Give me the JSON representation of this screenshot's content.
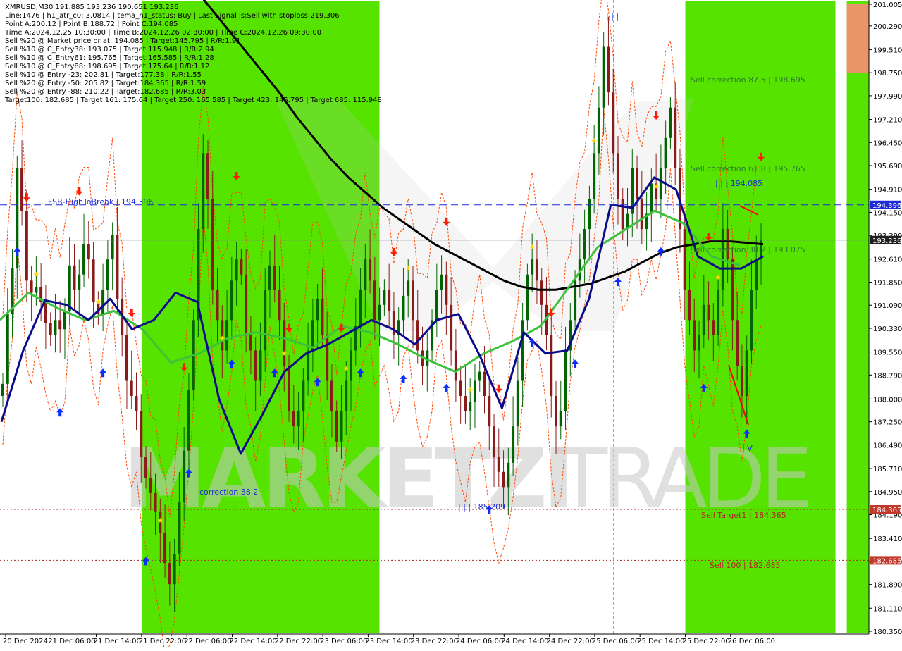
{
  "colors": {
    "background": "#ffffff",
    "bull_candle": "#006400",
    "bear_candle": "#8b1a1a",
    "zone_green": "#56e300",
    "zone_orange": "#e8956a",
    "ma_long": "#000000",
    "ma_mid": "#3cc23c",
    "ma_fast": "#0a0a8a",
    "level_line": "#1f2bd8",
    "target_line": "#b22222",
    "envelope": "#ff4500",
    "arrow_up": "#0a2cff",
    "arrow_down": "#ff1a00",
    "star": "#ffd400",
    "current_price_label_bg": "#202020",
    "level_label_bg": "#1f2bd8",
    "target_label_bg": "#c0392b",
    "watermark": "#c8c8c8",
    "watermark_green": "#1a8a5a"
  },
  "info_lines": [
    "XMRUSD,M30  191.885 193.236 190.651 193.236",
    "Line:1476  |  h1_atr_c0: 3.0814  |  tema_h1_status: Buy  |  Last Signal is:Sell with stoploss:219.306",
    "Point A:200.12  |  Point B:188.72  |  Point C:194.085",
    "Time A:2024.12.25 10:30:00  |  Time B:2024.12.26 02:30:00  |  Time C:2024.12.26 09:30:00",
    "Sell %20 @ Market price or at: 194.085  |  Target:145.795  |  R/R:1.91",
    "Sell %10 @ C_Entry38: 193.075  |  Target:115.948  |  R/R:2.94",
    "Sell %10 @ C_Entry61: 195.765  |  Target:165.585  |  R/R:1.28",
    "Sell %10 @ C_Entry88: 198.695  |  Target:175.64  |  R/R:1.12",
    "Sell %10 @ Entry -23: 202.81  |  Target:177.38  |  R/R:1.55",
    "Sell %20 @ Entry -50: 205.82  |  Target:184.365  |  R/R:1.59",
    "Sell %20 @ Entry -88: 210.22  |  Target:182.685  |  R/R:3.03",
    "Target100: 182.685  |  Target 161: 175.64  |  Target 250: 165.585  |  Target 423: 145.795  |  Target 685: 115.948"
  ],
  "annotations": {
    "fsb_label": "FSB-HighToBreak | 194.396",
    "sell_corr_875": "Sell correction 87.5 | 198.695",
    "sell_corr_618": "Sell correction 61.8 | 195.765",
    "sell_corr_382": "Sell correction 38.2 | 193.075",
    "point_c": "| | | 194.085",
    "point_b": "| | | 185.209",
    "point_a": "| | |",
    "point_v": "| V",
    "sell_target1": "Sell Target1 | 184.365",
    "sell_100": "Sell 100 | 182.685",
    "correction_382": "correction 38.2"
  },
  "watermark": {
    "left": "MARKETZI",
    "right": "TRADE"
  },
  "chart_data": {
    "type": "candlestick",
    "symbol": "XMRUSD",
    "timeframe": "M30",
    "ylim": [
      180.35,
      201.005
    ],
    "price_ticks": [
      "201.005",
      "200.290",
      "199.510",
      "198.750",
      "197.990",
      "197.210",
      "196.450",
      "195.690",
      "194.910",
      "194.150",
      "193.390",
      "192.610",
      "191.850",
      "191.090",
      "190.330",
      "189.550",
      "188.790",
      "188.000",
      "187.250",
      "186.490",
      "185.710",
      "184.950",
      "184.190",
      "183.410",
      "182.650",
      "181.890",
      "181.110",
      "180.350"
    ],
    "time_ticks": [
      "20 Dec 2024",
      "21 Dec 06:00",
      "21 Dec 14:00",
      "21 Dec 22:00",
      "22 Dec 06:00",
      "22 Dec 14:00",
      "22 Dec 22:00",
      "23 Dec 06:00",
      "23 Dec 14:00",
      "23 Dec 22:00",
      "24 Dec 06:00",
      "24 Dec 14:00",
      "24 Dec 22:00",
      "25 Dec 06:00",
      "25 Dec 14:00",
      "25 Dec 22:00",
      "26 Dec 06:00"
    ],
    "current_price": "193.236",
    "levels": [
      {
        "name": "FSB-HighToBreak",
        "price": 194.396,
        "label": "194.396",
        "style": "dashed"
      },
      {
        "name": "Sell Target1",
        "price": 184.365,
        "label": "184.365",
        "style": "dotted"
      },
      {
        "name": "Sell 100",
        "price": 182.685,
        "label": "182.685",
        "style": "dotted"
      }
    ],
    "green_zones": [
      {
        "from": "21 Dec 22:00",
        "to": "22 Dec 04:00"
      },
      {
        "from": "22 Dec 08:00",
        "to": "22 Dec 12:00"
      },
      {
        "from": "22 Dec 14:00",
        "to": "22 Dec 18:00"
      },
      {
        "from": "25 Dec 22:00",
        "to": "26 Dec 02:30"
      },
      {
        "from": "26 Dec 04:30",
        "to": "26 Dec 09:00"
      },
      {
        "from": "26 Dec 10:30",
        "to": "26 Dec 14:30"
      }
    ],
    "orange_zone": {
      "from": "26 Dec 04:30",
      "to": "26 Dec 09:00",
      "price_from": 198.75,
      "price_to": 201.005
    },
    "close_series": [
      188.5,
      190.8,
      192.3,
      195.6,
      194.2,
      191.9,
      191.5,
      191.7,
      191.2,
      190.5,
      190.1,
      190.6,
      190.3,
      190.9,
      192.4,
      191.6,
      192.1,
      193.1,
      192.6,
      191.2,
      190.8,
      191.6,
      192.6,
      193.4,
      191.3,
      190.1,
      188.6,
      188.1,
      187.6,
      186.1,
      185.4,
      184.9,
      184.3,
      183.6,
      182.6,
      181.9,
      182.9,
      184.6,
      186.3,
      188.3,
      190.6,
      193.6,
      196.1,
      194.6,
      191.6,
      190.6,
      189.6,
      190.6,
      191.9,
      192.6,
      192.1,
      190.1,
      189.6,
      188.6,
      189.6,
      191.6,
      192.4,
      191.6,
      190.6,
      189.1,
      187.6,
      187.1,
      187.6,
      188.6,
      189.6,
      190.6,
      191.3,
      190.1,
      188.6,
      187.6,
      186.6,
      187.6,
      188.6,
      189.6,
      190.4,
      191.6,
      192.6,
      191.9,
      190.6,
      191.1,
      191.6,
      190.9,
      190.1,
      190.6,
      191.4,
      191.9,
      190.6,
      189.6,
      189.1,
      189.6,
      190.6,
      191.6,
      192.1,
      191.1,
      189.6,
      188.6,
      188.1,
      187.6,
      187.9,
      188.6,
      188.9,
      188.1,
      187.1,
      186.1,
      185.6,
      185.1,
      185.9,
      187.1,
      188.6,
      190.6,
      192.1,
      192.6,
      191.9,
      191.1,
      190.1,
      188.1,
      187.1,
      187.6,
      189.6,
      190.6,
      191.9,
      192.6,
      193.6,
      194.6,
      196.1,
      197.6,
      199.6,
      198.1,
      196.1,
      194.6,
      193.6,
      194.1,
      195.6,
      194.6,
      193.6,
      194.1,
      195.1,
      194.6,
      195.6,
      196.6,
      197.6,
      195.6,
      193.6,
      191.6,
      190.6,
      189.6,
      190.1,
      191.1,
      190.6,
      190.1,
      191.6,
      193.6,
      192.6,
      190.6,
      189.1,
      188.1,
      189.6,
      191.6,
      192.6,
      193.236
    ],
    "ma_long_series": [
      203.6,
      203.2,
      202.4,
      201.6,
      200.9,
      200.2,
      199.5,
      198.8,
      198.1,
      197.3,
      196.6,
      195.9,
      195.3,
      194.8,
      194.3,
      193.9,
      193.5,
      193.1,
      192.8,
      192.5,
      192.2,
      191.9,
      191.7,
      191.6,
      191.6,
      191.7,
      191.8,
      192.0,
      192.2,
      192.5,
      192.8,
      193.0,
      193.1,
      193.2,
      193.2,
      193.15,
      193.1
    ],
    "ma_fast_series": [
      187.25,
      189.6,
      191.25,
      191.1,
      190.6,
      191.3,
      190.3,
      190.6,
      191.5,
      191.2,
      188.0,
      186.2,
      187.5,
      188.9,
      189.5,
      189.8,
      190.2,
      190.6,
      190.3,
      189.8,
      190.6,
      190.8,
      189.4,
      187.7,
      190.2,
      189.5,
      189.6,
      191.3,
      194.4,
      194.3,
      195.3,
      194.9,
      192.7,
      192.3,
      192.3,
      192.7
    ],
    "ma_mid_series": [
      190.6,
      191.5,
      191.0,
      190.6,
      190.9,
      190.3,
      189.2,
      189.5,
      190.0,
      190.2,
      190.0,
      189.7,
      190.4,
      190.2,
      189.8,
      189.3,
      188.9,
      189.5,
      189.9,
      190.4,
      191.7,
      193.0,
      193.6,
      194.2,
      193.8,
      192.7,
      192.4
    ]
  }
}
